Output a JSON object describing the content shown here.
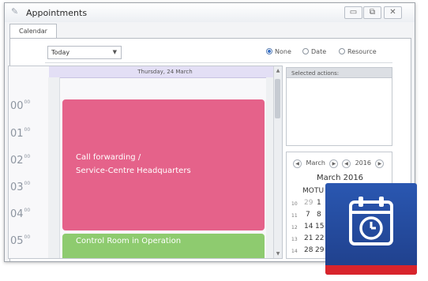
{
  "window": {
    "title": "Appointments",
    "controls": {
      "minimize": "▭",
      "maximize": "⧉",
      "close": "✕"
    }
  },
  "tabs": [
    {
      "label": "Calendar"
    }
  ],
  "toolbar": {
    "date_select": "Today",
    "radio": [
      {
        "label": "None",
        "checked": true
      },
      {
        "label": "Date",
        "checked": false
      },
      {
        "label": "Resource",
        "checked": false
      }
    ]
  },
  "schedule": {
    "day_header": "Thursday, 24 March",
    "hours": [
      "00",
      "01",
      "02",
      "03",
      "04",
      "05"
    ],
    "minute_superscript": "00",
    "appointments": [
      {
        "line1": "Call forwarding /",
        "line2": "Service-Centre Headquarters",
        "color": "#e5628a"
      },
      {
        "line1": "Control Room in Operation",
        "color": "#8ecb6f"
      }
    ]
  },
  "side": {
    "selected_actions_label": "Selected actions:",
    "calendar": {
      "month_nav": "March",
      "year_nav": "2016",
      "month_title": "March 2016",
      "weekday_headers": [
        "MO",
        "TU"
      ],
      "weeks": [
        {
          "wk": "10",
          "days": [
            "29",
            "1"
          ]
        },
        {
          "wk": "11",
          "days": [
            "7",
            "8"
          ]
        },
        {
          "wk": "12",
          "days": [
            "14",
            "15"
          ]
        },
        {
          "wk": "13",
          "days": [
            "21",
            "22"
          ]
        },
        {
          "wk": "14",
          "days": [
            "28",
            "29"
          ]
        }
      ]
    }
  },
  "badge": {
    "icon": "calendar-clock-icon",
    "color": "#2a57b1",
    "accent": "#d8242c"
  }
}
